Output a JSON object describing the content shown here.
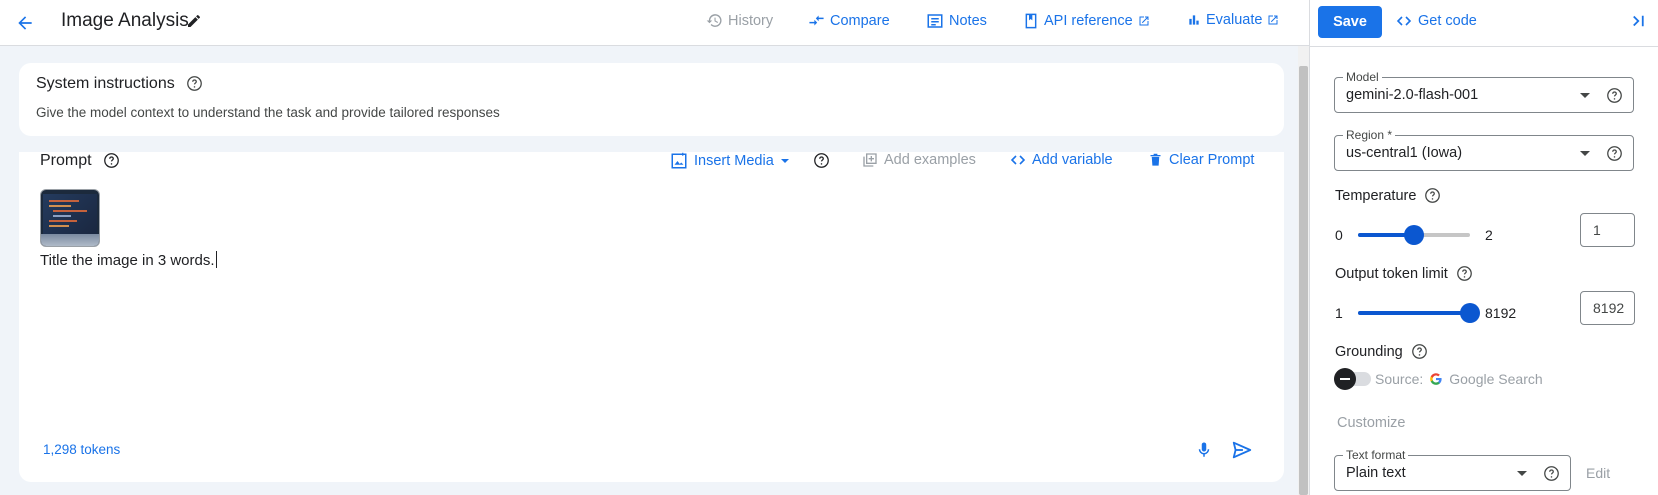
{
  "header": {
    "title": "Image Analysis",
    "nav": {
      "history": "History",
      "compare": "Compare",
      "notes": "Notes",
      "api_reference": "API reference",
      "evaluate": "Evaluate"
    }
  },
  "system_instructions": {
    "title": "System instructions",
    "description": "Give the model context to understand the task and provide tailored responses"
  },
  "prompt": {
    "title": "Prompt",
    "tools": {
      "insert_media": "Insert Media",
      "add_examples": "Add examples",
      "add_variable": "Add variable",
      "clear_prompt": "Clear Prompt"
    },
    "text": "Title the image in 3 words.",
    "tokens": "1,298 tokens"
  },
  "right_panel": {
    "save_label": "Save",
    "get_code_label": "Get code",
    "model": {
      "label": "Model",
      "value": "gemini-2.0-flash-001"
    },
    "region": {
      "label": "Region *",
      "value": "us-central1 (Iowa)"
    },
    "temperature": {
      "label": "Temperature",
      "min": "0",
      "max": "2",
      "value": "1",
      "fraction": 0.5
    },
    "output_token_limit": {
      "label": "Output token limit",
      "min": "1",
      "max": "8192",
      "value": "8192",
      "fraction": 1.0
    },
    "grounding": {
      "label": "Grounding",
      "source_prefix": "Source:",
      "source_name": "Google Search",
      "enabled": false
    },
    "customize_label": "Customize",
    "text_format": {
      "label": "Text format",
      "value": "Plain text"
    },
    "edit_label": "Edit"
  },
  "colors": {
    "accent": "#1a73e8",
    "slider": "#0b57d0",
    "disabled": "#9aa0a6",
    "background": "#f0f4f9"
  }
}
